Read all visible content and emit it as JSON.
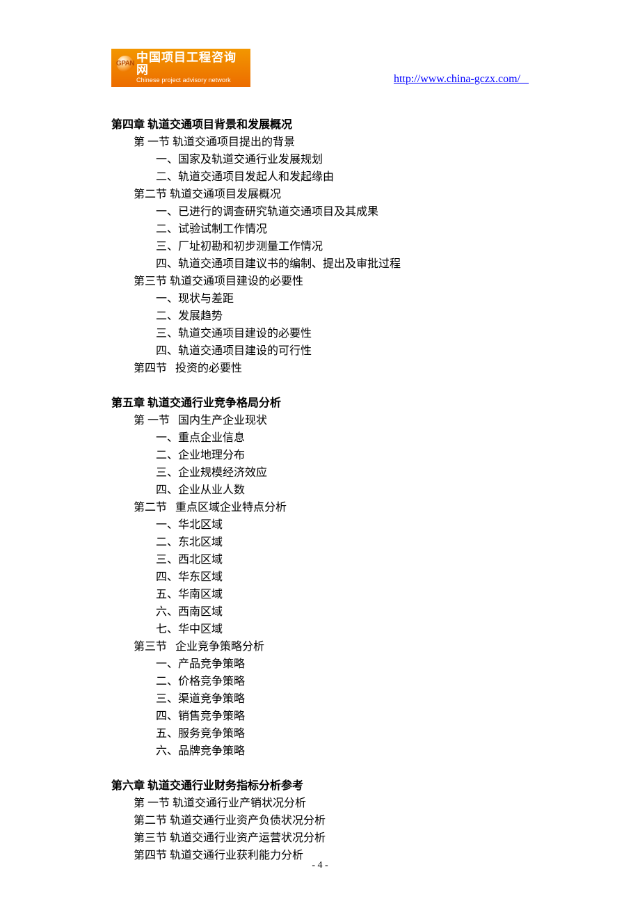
{
  "header": {
    "logo_circle_text": "GPAN",
    "logo_cn": "中国项目工程咨询网",
    "logo_en": "Chinese project advisory network",
    "site_url": "http://www.china-gczx.com/   "
  },
  "chapters": [
    {
      "title": "第四章 轨道交通项目背景和发展概况",
      "sections": [
        {
          "title": "第 一节 轨道交通项目提出的背景",
          "items": [
            "一、国家及轨道交通行业发展规划",
            "二、轨道交通项目发起人和发起缘由"
          ]
        },
        {
          "title": "第二节 轨道交通项目发展概况",
          "items": [
            "一、已进行的调查研究轨道交通项目及其成果",
            "二、试验试制工作情况",
            "三、厂址初勘和初步测量工作情况",
            "四、轨道交通项目建议书的编制、提出及审批过程"
          ]
        },
        {
          "title": "第三节 轨道交通项目建设的必要性",
          "items": [
            "一、现状与差距",
            "二、发展趋势",
            "三、轨道交通项目建设的必要性",
            "四、轨道交通项目建设的可行性"
          ]
        },
        {
          "title": "第四节   投资的必要性",
          "items": []
        }
      ]
    },
    {
      "title": "第五章 轨道交通行业竞争格局分析",
      "sections": [
        {
          "title": "第 一节   国内生产企业现状",
          "items": [
            "一、重点企业信息",
            "二、企业地理分布",
            "三、企业规模经济效应",
            "四、企业从业人数"
          ]
        },
        {
          "title": "第二节   重点区域企业特点分析",
          "items": [
            "一、华北区域",
            "二、东北区域",
            "三、西北区域",
            "四、华东区域",
            "五、华南区域",
            "六、西南区域",
            "七、华中区域"
          ]
        },
        {
          "title": "第三节   企业竞争策略分析",
          "items": [
            "一、产品竞争策略",
            "二、价格竞争策略",
            "三、渠道竞争策略",
            "四、销售竞争策略",
            "五、服务竞争策略",
            "六、品牌竞争策略"
          ]
        }
      ]
    },
    {
      "title": "第六章 轨道交通行业财务指标分析参考",
      "sections": [
        {
          "title": "第 一节 轨道交通行业产销状况分析",
          "items": []
        },
        {
          "title": "第二节 轨道交通行业资产负债状况分析",
          "items": []
        },
        {
          "title": "第三节 轨道交通行业资产运营状况分析",
          "items": []
        },
        {
          "title": "第四节 轨道交通行业获利能力分析",
          "items": []
        }
      ]
    }
  ],
  "page_number": "- 4 -"
}
